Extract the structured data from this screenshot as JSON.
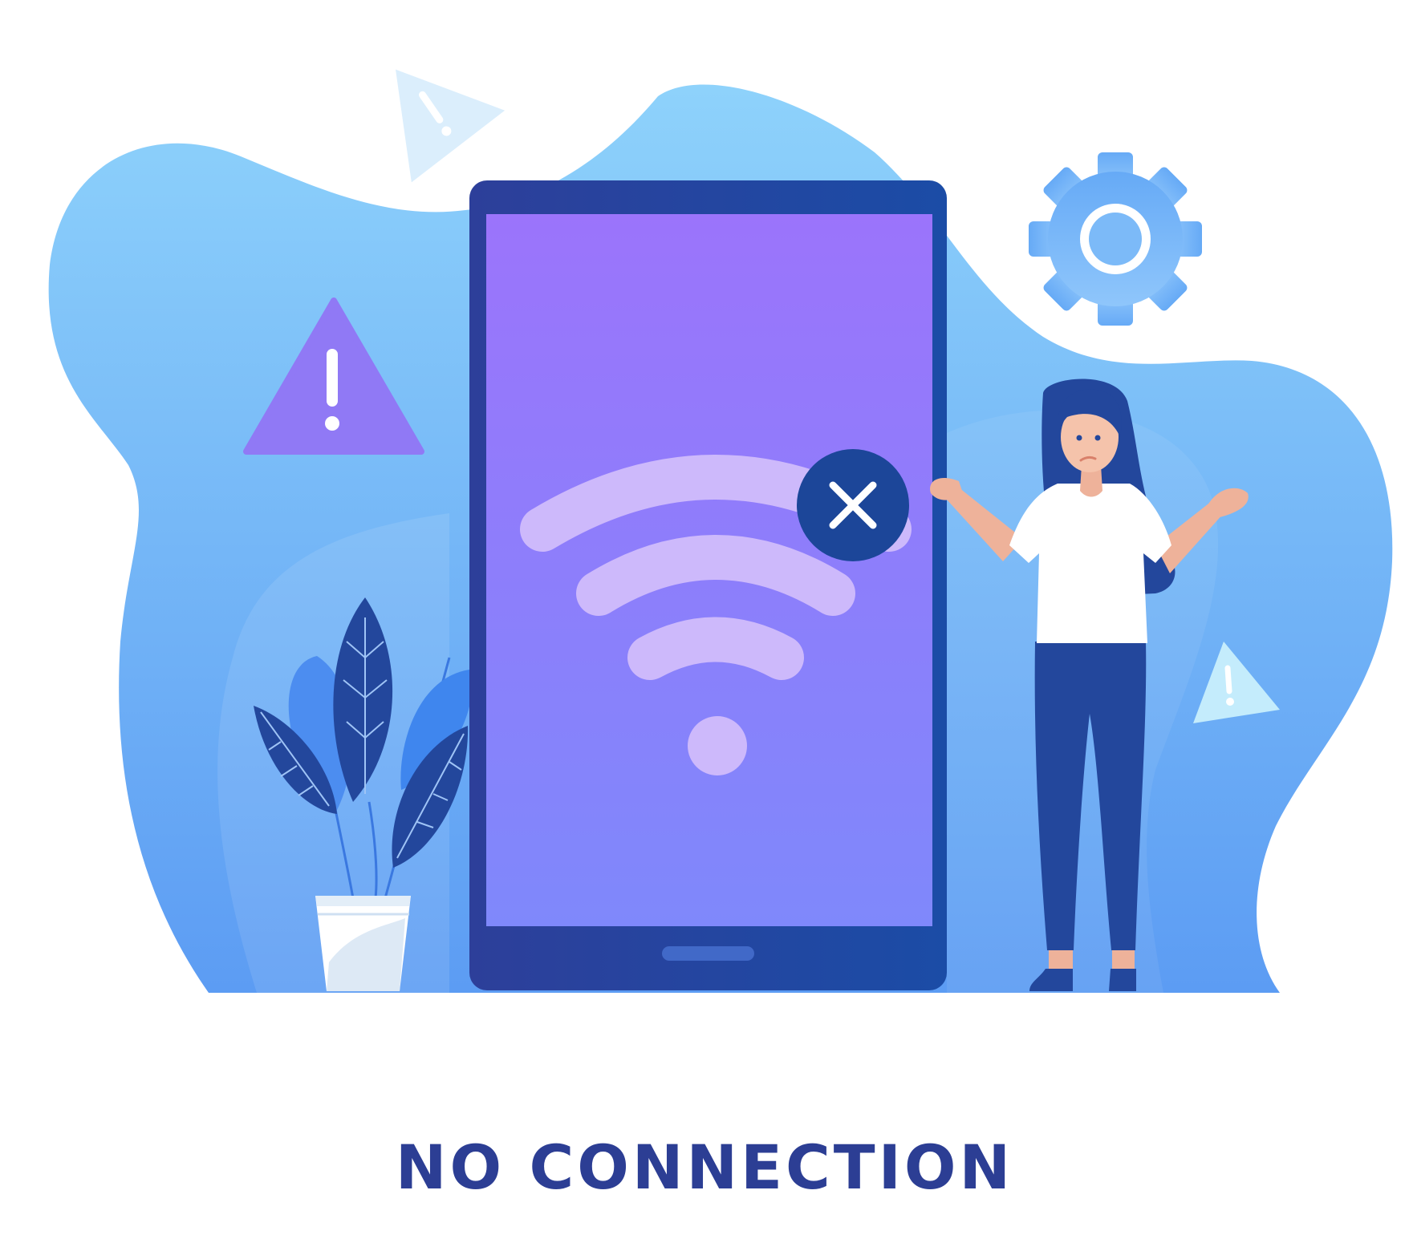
{
  "headline": "NO CONNECTION",
  "colors": {
    "headline": "#2c3e94",
    "blob_top": "#8ed2fb",
    "blob_bottom": "#5c9cf3",
    "device_frame": "#23479c",
    "screen_top": "#9b74fb",
    "screen_bottom": "#7f88fb",
    "wifi_waves": "#cdb9fb",
    "error_badge": "#1c4699",
    "warning_purple": "#9079f5",
    "gear": "#6fb2f8"
  },
  "icons": [
    "phone-icon",
    "wifi-icon",
    "error-x-icon",
    "warning-icon",
    "gear-icon",
    "plant-icon",
    "person-illustration"
  ]
}
